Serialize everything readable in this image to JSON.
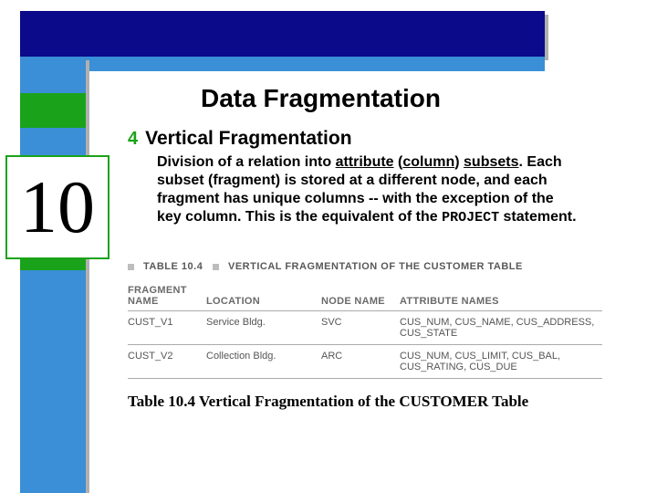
{
  "chapter_number": "10",
  "title": "Data Fragmentation",
  "bullet_label": "Vertical Fragmentation",
  "body": {
    "p1": "Division of a relation into ",
    "u1": "attribute",
    "p2": " (",
    "u2": "column",
    "p3": ") ",
    "u3": "subsets",
    "p4": ". Each subset (fragment) is stored at a different node, and each fragment has unique columns -- with the exception of the key column. This is the equivalent of the ",
    "mono": "PROJECT",
    "p5": " statement."
  },
  "table": {
    "title_prefix": "TABLE 10.4",
    "title_rest": "VERTICAL FRAGMENTATION OF THE ",
    "title_bold": "CUSTOMER",
    "title_tail": " TABLE",
    "headers": {
      "fragment": "FRAGMENT NAME",
      "location": "LOCATION",
      "node": "NODE NAME",
      "attrs": "ATTRIBUTE NAMES"
    },
    "rows": [
      {
        "fragment": "CUST_V1",
        "location": "Service Bldg.",
        "node": "SVC",
        "attrs": "CUS_NUM, CUS_NAME, CUS_ADDRESS, CUS_STATE"
      },
      {
        "fragment": "CUST_V2",
        "location": "Collection Bldg.",
        "node": "ARC",
        "attrs": "CUS_NUM, CUS_LIMIT, CUS_BAL, CUS_RATING, CUS_DUE"
      }
    ]
  },
  "caption": "Table 10.4  Vertical Fragmentation of the CUSTOMER Table"
}
